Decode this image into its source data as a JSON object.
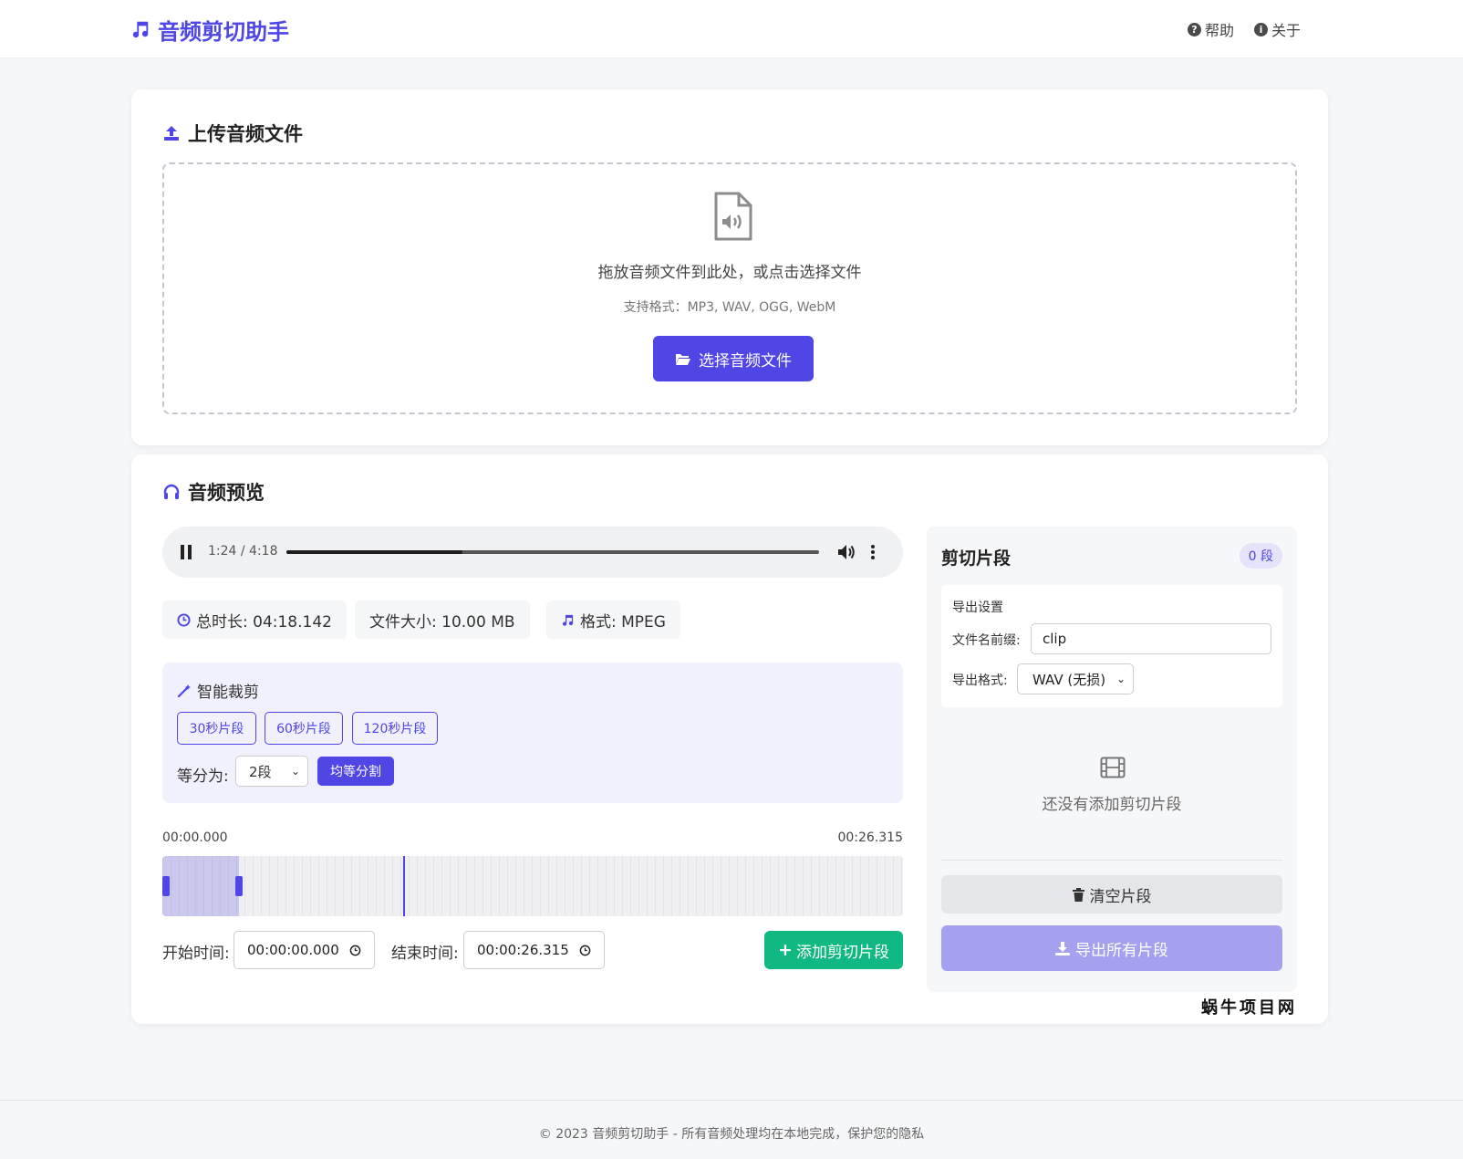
{
  "header": {
    "app_title": "音频剪切助手",
    "nav": [
      {
        "label": "帮助",
        "icon": "help-icon"
      },
      {
        "label": "关于",
        "icon": "info-icon"
      }
    ]
  },
  "upload": {
    "title": "上传音频文件",
    "drop_text": "拖放音频文件到此处，或点击选择文件",
    "formats_hint": "支持格式：MP3, WAV, OGG, WebM",
    "choose_button": "选择音频文件"
  },
  "preview": {
    "title": "音频预览",
    "player": {
      "time_display": "1:24 / 4:18",
      "progress": 0.33,
      "state": "playing"
    },
    "info": {
      "duration": "总时长: 04:18.142",
      "size": "文件大小: 10.00 MB",
      "format": "格式: MPEG"
    },
    "smart_clip": {
      "title": "智能裁剪",
      "preset_buttons": [
        "30秒片段",
        "60秒片段",
        "120秒片段"
      ],
      "split_label": "等分为:",
      "split_value": "2段",
      "split_button": "均等分割"
    },
    "waveform": {
      "start_label": "00:00.000",
      "end_label": "00:26.315",
      "selection_start_fraction": 0.0,
      "selection_end_fraction": 0.104,
      "cursor_fraction": 0.325
    },
    "range": {
      "start_label": "开始时间:",
      "start_value": "00:00:00.000",
      "end_label": "结束时间:",
      "end_value": "00:00:26.315",
      "add_button": "添加剪切片段"
    }
  },
  "clips_panel": {
    "title": "剪切片段",
    "count_badge": "0 段",
    "export_settings": {
      "title": "导出设置",
      "prefix_label": "文件名前缀:",
      "prefix_value": "clip",
      "format_label": "导出格式:",
      "format_value": "WAV (无损)"
    },
    "empty_text": "还没有添加剪切片段",
    "clear_button": "清空片段",
    "export_button": "导出所有片段"
  },
  "watermark": "蜗牛项目网",
  "footer": {
    "text": "© 2023 音频剪切助手 - 所有音频处理均在本地完成，保护您的隐私"
  },
  "colors": {
    "primary": "#4f46e5",
    "success": "#10b981",
    "export_disabled": "#a5a1ef"
  }
}
